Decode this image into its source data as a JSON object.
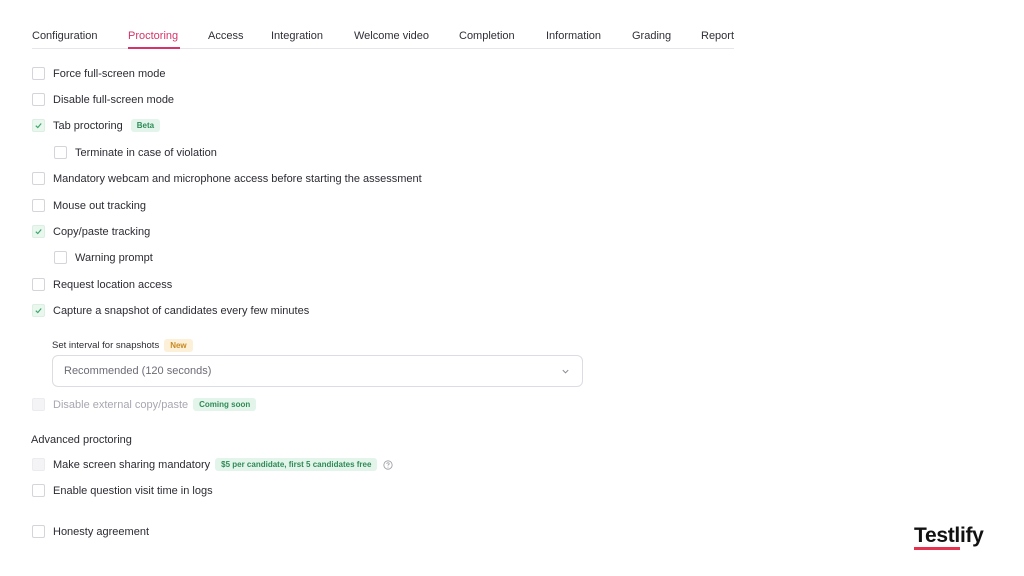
{
  "tabs": [
    {
      "label": "Configuration",
      "active": false
    },
    {
      "label": "Proctoring",
      "active": true
    },
    {
      "label": "Access",
      "active": false
    },
    {
      "label": "Integration",
      "active": false
    },
    {
      "label": "Welcome video",
      "active": false
    },
    {
      "label": "Completion",
      "active": false
    },
    {
      "label": "Information",
      "active": false
    },
    {
      "label": "Grading",
      "active": false
    },
    {
      "label": "Report",
      "active": false
    }
  ],
  "options": {
    "force_fullscreen": {
      "label": "Force full-screen mode",
      "checked": false
    },
    "disable_fullscreen": {
      "label": "Disable full-screen mode",
      "checked": false
    },
    "tab_proctoring": {
      "label": "Tab proctoring",
      "checked": true,
      "badge": "Beta"
    },
    "terminate_violation": {
      "label": "Terminate in case of violation",
      "checked": false
    },
    "mandatory_webcam": {
      "label": "Mandatory webcam and microphone access before starting the assessment",
      "checked": false
    },
    "mouse_out": {
      "label": "Mouse out tracking",
      "checked": false
    },
    "copy_paste": {
      "label": "Copy/paste tracking",
      "checked": true
    },
    "warning_prompt": {
      "label": "Warning prompt",
      "checked": false
    },
    "location_access": {
      "label": "Request location access",
      "checked": false
    },
    "snapshot": {
      "label": "Capture a snapshot of candidates every few minutes",
      "checked": true
    },
    "disable_external_copy": {
      "label": "Disable external copy/paste",
      "checked": false,
      "disabled": true,
      "badge": "Coming soon"
    }
  },
  "snapshot_interval": {
    "label": "Set interval for snapshots",
    "badge": "New",
    "value": "Recommended (120 seconds)"
  },
  "advanced": {
    "title": "Advanced proctoring",
    "screen_sharing": {
      "label": "Make screen sharing mandatory",
      "checked": false,
      "disabled": true,
      "badge": "$5 per candidate, first 5 candidates free"
    },
    "question_visit": {
      "label": "Enable question visit time in logs",
      "checked": false
    },
    "honesty": {
      "label": "Honesty agreement",
      "checked": false
    }
  },
  "brand": {
    "logo_text": "Testlify",
    "accent": "#d6336c",
    "check_color": "#3aa56a"
  }
}
